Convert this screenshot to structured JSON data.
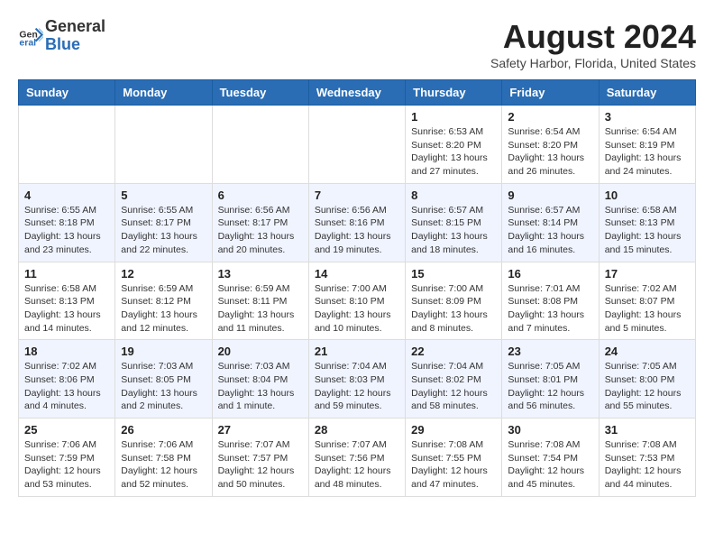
{
  "header": {
    "logo_general": "General",
    "logo_blue": "Blue",
    "month_title": "August 2024",
    "location": "Safety Harbor, Florida, United States"
  },
  "days_of_week": [
    "Sunday",
    "Monday",
    "Tuesday",
    "Wednesday",
    "Thursday",
    "Friday",
    "Saturday"
  ],
  "weeks": [
    [
      {
        "day": "",
        "info": ""
      },
      {
        "day": "",
        "info": ""
      },
      {
        "day": "",
        "info": ""
      },
      {
        "day": "",
        "info": ""
      },
      {
        "day": "1",
        "info": "Sunrise: 6:53 AM\nSunset: 8:20 PM\nDaylight: 13 hours\nand 27 minutes."
      },
      {
        "day": "2",
        "info": "Sunrise: 6:54 AM\nSunset: 8:20 PM\nDaylight: 13 hours\nand 26 minutes."
      },
      {
        "day": "3",
        "info": "Sunrise: 6:54 AM\nSunset: 8:19 PM\nDaylight: 13 hours\nand 24 minutes."
      }
    ],
    [
      {
        "day": "4",
        "info": "Sunrise: 6:55 AM\nSunset: 8:18 PM\nDaylight: 13 hours\nand 23 minutes."
      },
      {
        "day": "5",
        "info": "Sunrise: 6:55 AM\nSunset: 8:17 PM\nDaylight: 13 hours\nand 22 minutes."
      },
      {
        "day": "6",
        "info": "Sunrise: 6:56 AM\nSunset: 8:17 PM\nDaylight: 13 hours\nand 20 minutes."
      },
      {
        "day": "7",
        "info": "Sunrise: 6:56 AM\nSunset: 8:16 PM\nDaylight: 13 hours\nand 19 minutes."
      },
      {
        "day": "8",
        "info": "Sunrise: 6:57 AM\nSunset: 8:15 PM\nDaylight: 13 hours\nand 18 minutes."
      },
      {
        "day": "9",
        "info": "Sunrise: 6:57 AM\nSunset: 8:14 PM\nDaylight: 13 hours\nand 16 minutes."
      },
      {
        "day": "10",
        "info": "Sunrise: 6:58 AM\nSunset: 8:13 PM\nDaylight: 13 hours\nand 15 minutes."
      }
    ],
    [
      {
        "day": "11",
        "info": "Sunrise: 6:58 AM\nSunset: 8:13 PM\nDaylight: 13 hours\nand 14 minutes."
      },
      {
        "day": "12",
        "info": "Sunrise: 6:59 AM\nSunset: 8:12 PM\nDaylight: 13 hours\nand 12 minutes."
      },
      {
        "day": "13",
        "info": "Sunrise: 6:59 AM\nSunset: 8:11 PM\nDaylight: 13 hours\nand 11 minutes."
      },
      {
        "day": "14",
        "info": "Sunrise: 7:00 AM\nSunset: 8:10 PM\nDaylight: 13 hours\nand 10 minutes."
      },
      {
        "day": "15",
        "info": "Sunrise: 7:00 AM\nSunset: 8:09 PM\nDaylight: 13 hours\nand 8 minutes."
      },
      {
        "day": "16",
        "info": "Sunrise: 7:01 AM\nSunset: 8:08 PM\nDaylight: 13 hours\nand 7 minutes."
      },
      {
        "day": "17",
        "info": "Sunrise: 7:02 AM\nSunset: 8:07 PM\nDaylight: 13 hours\nand 5 minutes."
      }
    ],
    [
      {
        "day": "18",
        "info": "Sunrise: 7:02 AM\nSunset: 8:06 PM\nDaylight: 13 hours\nand 4 minutes."
      },
      {
        "day": "19",
        "info": "Sunrise: 7:03 AM\nSunset: 8:05 PM\nDaylight: 13 hours\nand 2 minutes."
      },
      {
        "day": "20",
        "info": "Sunrise: 7:03 AM\nSunset: 8:04 PM\nDaylight: 13 hours\nand 1 minute."
      },
      {
        "day": "21",
        "info": "Sunrise: 7:04 AM\nSunset: 8:03 PM\nDaylight: 12 hours\nand 59 minutes."
      },
      {
        "day": "22",
        "info": "Sunrise: 7:04 AM\nSunset: 8:02 PM\nDaylight: 12 hours\nand 58 minutes."
      },
      {
        "day": "23",
        "info": "Sunrise: 7:05 AM\nSunset: 8:01 PM\nDaylight: 12 hours\nand 56 minutes."
      },
      {
        "day": "24",
        "info": "Sunrise: 7:05 AM\nSunset: 8:00 PM\nDaylight: 12 hours\nand 55 minutes."
      }
    ],
    [
      {
        "day": "25",
        "info": "Sunrise: 7:06 AM\nSunset: 7:59 PM\nDaylight: 12 hours\nand 53 minutes."
      },
      {
        "day": "26",
        "info": "Sunrise: 7:06 AM\nSunset: 7:58 PM\nDaylight: 12 hours\nand 52 minutes."
      },
      {
        "day": "27",
        "info": "Sunrise: 7:07 AM\nSunset: 7:57 PM\nDaylight: 12 hours\nand 50 minutes."
      },
      {
        "day": "28",
        "info": "Sunrise: 7:07 AM\nSunset: 7:56 PM\nDaylight: 12 hours\nand 48 minutes."
      },
      {
        "day": "29",
        "info": "Sunrise: 7:08 AM\nSunset: 7:55 PM\nDaylight: 12 hours\nand 47 minutes."
      },
      {
        "day": "30",
        "info": "Sunrise: 7:08 AM\nSunset: 7:54 PM\nDaylight: 12 hours\nand 45 minutes."
      },
      {
        "day": "31",
        "info": "Sunrise: 7:08 AM\nSunset: 7:53 PM\nDaylight: 12 hours\nand 44 minutes."
      }
    ]
  ]
}
